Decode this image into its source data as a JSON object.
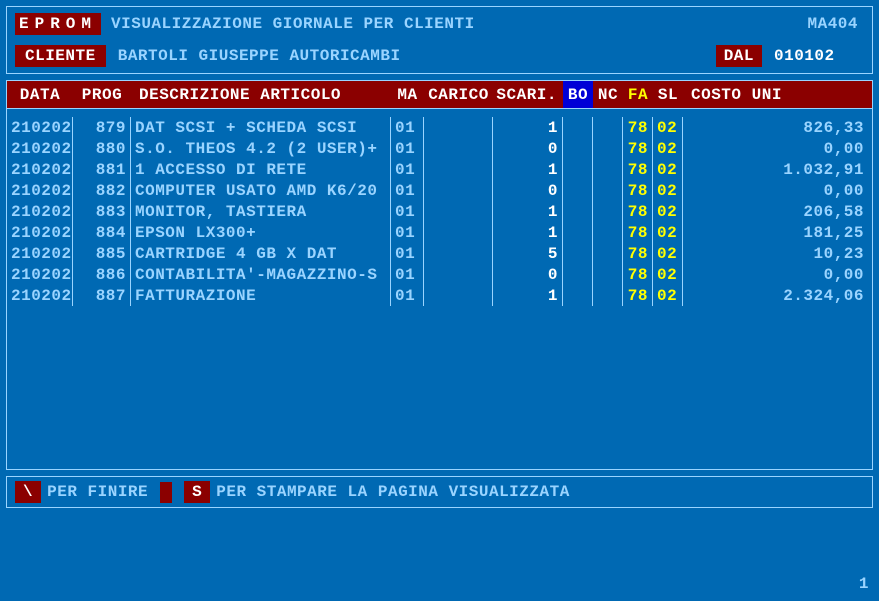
{
  "header": {
    "eprom": "EPROM",
    "title": "VISUALIZZAZIONE GIORNALE PER CLIENTI",
    "code": "MA404"
  },
  "client": {
    "label": "CLIENTE",
    "name": "BARTOLI GIUSEPPE AUTORICAMBI",
    "dal_label": "DAL",
    "dal_value": "010102"
  },
  "columns": {
    "data": "DATA",
    "prog": "PROG",
    "desc": "DESCRIZIONE ARTICOLO",
    "ma": "MA",
    "carico": "CARICO",
    "scari": "SCARI.",
    "bo": "BO",
    "nc": "NC",
    "fa": "FA",
    "sl": "SL",
    "costo": "COSTO UNI"
  },
  "rows": [
    {
      "data": "210202",
      "prog": "879",
      "desc": "DAT SCSI + SCHEDA SCSI",
      "ma": "01",
      "carico": "",
      "scari": "1",
      "bo": "",
      "nc": "",
      "fa": "78",
      "sl": "02",
      "costo": "826,33"
    },
    {
      "data": "210202",
      "prog": "880",
      "desc": "S.O. THEOS 4.2 (2 USER)+",
      "ma": "01",
      "carico": "",
      "scari": "0",
      "bo": "",
      "nc": "",
      "fa": "78",
      "sl": "02",
      "costo": "0,00"
    },
    {
      "data": "210202",
      "prog": "881",
      "desc": "1 ACCESSO DI RETE",
      "ma": "01",
      "carico": "",
      "scari": "1",
      "bo": "",
      "nc": "",
      "fa": "78",
      "sl": "02",
      "costo": "1.032,91"
    },
    {
      "data": "210202",
      "prog": "882",
      "desc": "COMPUTER USATO AMD K6/20",
      "ma": "01",
      "carico": "",
      "scari": "0",
      "bo": "",
      "nc": "",
      "fa": "78",
      "sl": "02",
      "costo": "0,00"
    },
    {
      "data": "210202",
      "prog": "883",
      "desc": "MONITOR, TASTIERA",
      "ma": "01",
      "carico": "",
      "scari": "1",
      "bo": "",
      "nc": "",
      "fa": "78",
      "sl": "02",
      "costo": "206,58"
    },
    {
      "data": "210202",
      "prog": "884",
      "desc": "EPSON LX300+",
      "ma": "01",
      "carico": "",
      "scari": "1",
      "bo": "",
      "nc": "",
      "fa": "78",
      "sl": "02",
      "costo": "181,25"
    },
    {
      "data": "210202",
      "prog": "885",
      "desc": "CARTRIDGE 4 GB X DAT",
      "ma": "01",
      "carico": "",
      "scari": "5",
      "bo": "",
      "nc": "",
      "fa": "78",
      "sl": "02",
      "costo": "10,23"
    },
    {
      "data": "210202",
      "prog": "886",
      "desc": "CONTABILITA'-MAGAZZINO-S",
      "ma": "01",
      "carico": "",
      "scari": "0",
      "bo": "",
      "nc": "",
      "fa": "78",
      "sl": "02",
      "costo": "0,00"
    },
    {
      "data": "210202",
      "prog": "887",
      "desc": "FATTURAZIONE",
      "ma": "01",
      "carico": "",
      "scari": "1",
      "bo": "",
      "nc": "",
      "fa": "78",
      "sl": "02",
      "costo": "2.324,06"
    }
  ],
  "footer": {
    "key_back": "\\",
    "key_back_desc": "PER FINIRE",
    "key_print": "S",
    "key_print_desc": "PER STAMPARE LA PAGINA VISUALIZZATA"
  },
  "page": "1"
}
